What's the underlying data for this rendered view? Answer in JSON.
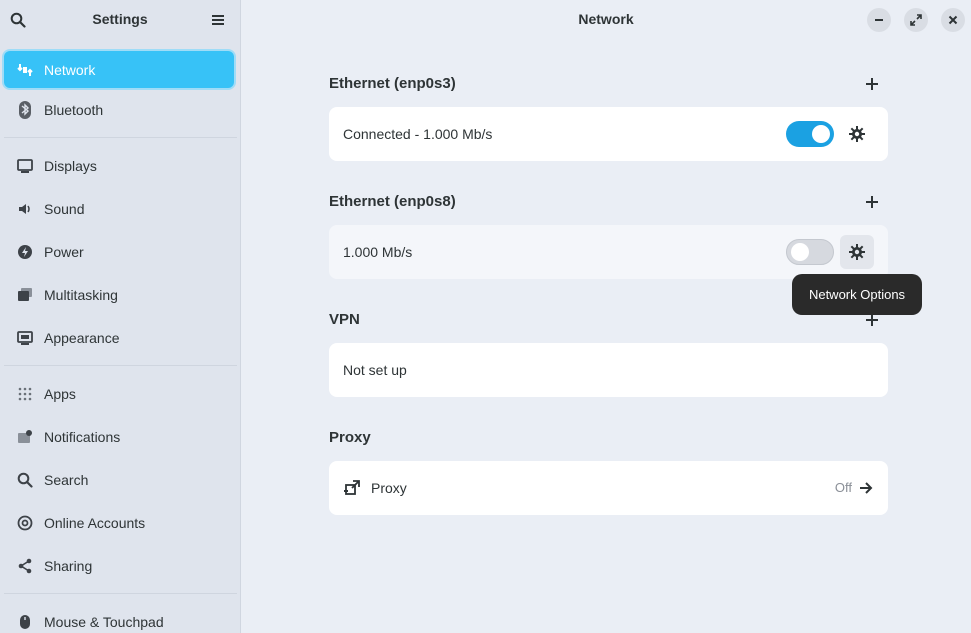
{
  "sidebar": {
    "title": "Settings",
    "items": [
      {
        "label": "Network",
        "icon": "network-icon"
      },
      {
        "label": "Bluetooth",
        "icon": "bluetooth-icon"
      },
      {
        "label": "Displays",
        "icon": "display-icon"
      },
      {
        "label": "Sound",
        "icon": "speaker-icon"
      },
      {
        "label": "Power",
        "icon": "power-icon"
      },
      {
        "label": "Multitasking",
        "icon": "multitasking-icon"
      },
      {
        "label": "Appearance",
        "icon": "appearance-icon"
      },
      {
        "label": "Apps",
        "icon": "apps-grid-icon"
      },
      {
        "label": "Notifications",
        "icon": "notifications-icon"
      },
      {
        "label": "Search",
        "icon": "search-icon"
      },
      {
        "label": "Online Accounts",
        "icon": "at-sign-icon"
      },
      {
        "label": "Sharing",
        "icon": "share-icon"
      },
      {
        "label": "Mouse & Touchpad",
        "icon": "mouse-icon"
      }
    ]
  },
  "main": {
    "title": "Network",
    "sections": [
      {
        "heading": "Ethernet (enp0s3)",
        "row_text": "Connected - 1.000 Mb/s",
        "switch_on": true
      },
      {
        "heading": "Ethernet (enp0s8)",
        "row_text": "1.000 Mb/s",
        "switch_on": false
      },
      {
        "heading": "VPN",
        "row_text": "Not set up"
      },
      {
        "heading": "Proxy",
        "row_text": "Proxy",
        "status": "Off"
      }
    ],
    "tooltip": "Network Options"
  },
  "colors": {
    "accent": "#37c2f7",
    "switch_on": "#1ba1e2",
    "sidebar_bg": "#dfe4ed",
    "main_bg": "#eaeef5"
  }
}
